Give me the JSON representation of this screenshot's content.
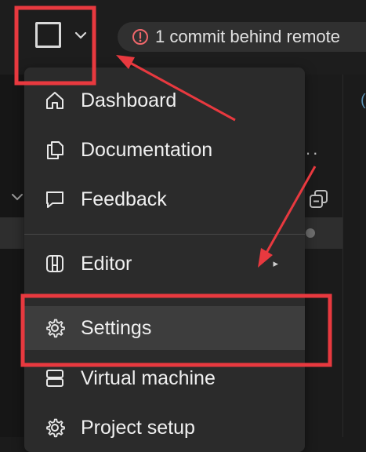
{
  "topbar": {
    "status_text": "1 commit behind remote"
  },
  "menu": {
    "items": [
      {
        "label": "Dashboard",
        "icon": "home-icon"
      },
      {
        "label": "Documentation",
        "icon": "document-icon"
      },
      {
        "label": "Feedback",
        "icon": "chat-bubble-icon"
      },
      {
        "label": "Editor",
        "icon": "editor-layout-icon",
        "submenu": true
      },
      {
        "label": "Settings",
        "icon": "gear-icon",
        "active": true
      },
      {
        "label": "Virtual machine",
        "icon": "server-icon"
      },
      {
        "label": "Project setup",
        "icon": "gear-icon"
      }
    ]
  },
  "colors": {
    "highlight_box": "#e8393f",
    "menu_bg": "#2b2b2b",
    "active_item_bg": "#3d3d3d"
  }
}
